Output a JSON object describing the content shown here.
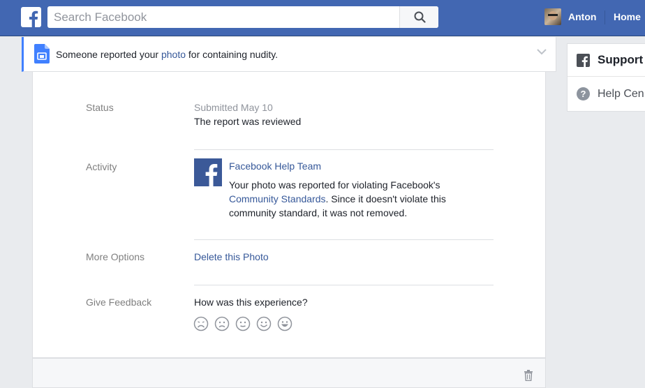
{
  "topbar": {
    "search_placeholder": "Search Facebook",
    "profile_name": "Anton",
    "home_label": "Home",
    "brand_color": "#4267b2"
  },
  "report": {
    "title_before": "Someone reported your ",
    "title_link": "photo",
    "title_after": " for containing nudity.",
    "status": {
      "label": "Status",
      "date": "Submitted May 10",
      "text": "The report was reviewed"
    },
    "activity": {
      "label": "Activity",
      "sender": "Facebook Help Team",
      "message_before": "Your photo was reported for violating Facebook's ",
      "message_link": "Community Standards",
      "message_after": ". Since it doesn't violate this community standard, it was not removed."
    },
    "more_options": {
      "label": "More Options",
      "delete_link": "Delete this Photo"
    },
    "feedback": {
      "label": "Give Feedback",
      "question": "How was this experience?",
      "faces": [
        "very-unhappy-face-icon",
        "unhappy-face-icon",
        "neutral-face-icon",
        "happy-face-icon",
        "very-happy-face-icon"
      ]
    }
  },
  "sidebar": {
    "title": "Support",
    "help_link": "Help Cen"
  }
}
